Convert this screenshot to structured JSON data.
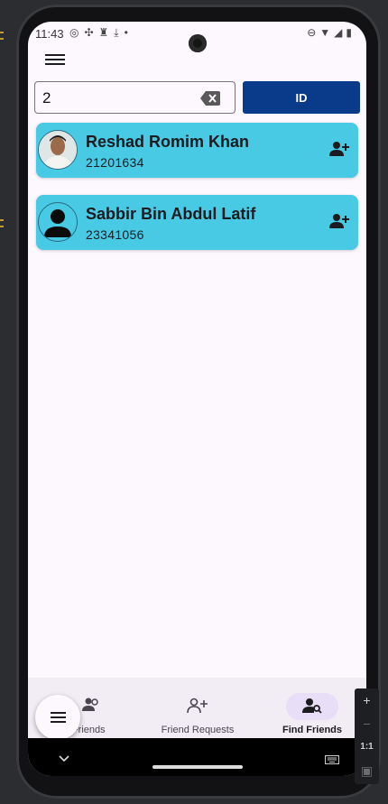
{
  "status_bar": {
    "time": "11:43"
  },
  "search": {
    "value": "2",
    "placeholder": ""
  },
  "id_button_label": "ID",
  "results": [
    {
      "name": "Reshad Romim Khan",
      "id": "21201634",
      "avatar": "photo"
    },
    {
      "name": "Sabbir Bin Abdul Latif",
      "id": "23341056",
      "avatar": "default"
    }
  ],
  "bottom_nav": {
    "items": [
      {
        "label": "y Friends",
        "icon": "friends-icon"
      },
      {
        "label": "Friend Requests",
        "icon": "person-add-icon"
      },
      {
        "label": "Find Friends",
        "icon": "person-search-icon",
        "selected": true
      }
    ]
  },
  "emulator_toolbar": {
    "plus": "+",
    "minus": "−",
    "ratio": "1:1"
  },
  "colors": {
    "card": "#48c9e4",
    "id_button": "#0a3a8a",
    "nav_bg": "#f2ecf4",
    "selected_pill": "#e8def8"
  }
}
